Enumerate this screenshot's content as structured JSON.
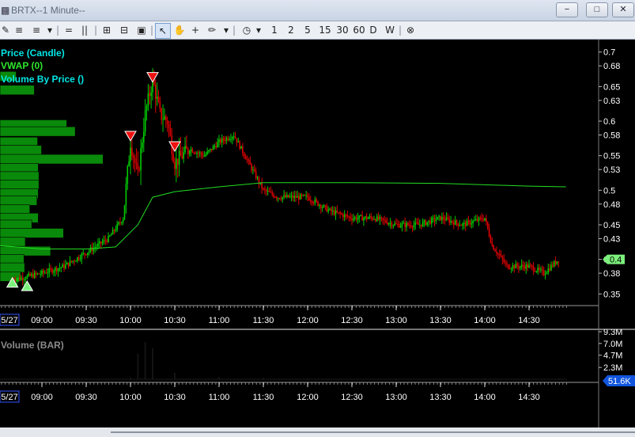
{
  "window": {
    "title": "BRTX--1 Minute--",
    "buttons": [
      "−",
      "□",
      "✕"
    ]
  },
  "toolbar": {
    "intervals": [
      "1",
      "2",
      "5",
      "15",
      "30",
      "60",
      "D",
      "W"
    ]
  },
  "price_legend": [
    {
      "label": "Price (Candle)",
      "color": "#00e5e5"
    },
    {
      "label": "VWAP (0)",
      "color": "#2ee62e"
    },
    {
      "label": "Volume By Price ()",
      "color": "#00e5e5"
    }
  ],
  "volume_legend": {
    "label": "Volume (BAR)",
    "color": "#8a8a8a"
  },
  "current_price_label": "0.4",
  "current_volume_label": "51.6K",
  "colors": {
    "background": "#000000",
    "up_candle": "#00cc00",
    "down_candle": "#dd0000",
    "vwap": "#22dd22",
    "volume_profile": "#0a8a0a",
    "axis_text": "#ffffff",
    "current_price_badge": "#7cf07c",
    "current_volume_badge": "#1155dd"
  },
  "chart_data": [
    {
      "type": "candlestick",
      "title": "Price (Candle)",
      "x_ticks": [
        "5/27",
        "09:00",
        "09:30",
        "10:00",
        "10:30",
        "11:00",
        "11:30",
        "12:00",
        "12:30",
        "13:00",
        "13:30",
        "14:00",
        "14:30"
      ],
      "y_ticks": [
        0.7,
        0.68,
        0.65,
        0.63,
        0.6,
        0.58,
        0.55,
        0.53,
        0.5,
        0.48,
        0.45,
        0.43,
        0.4,
        0.38,
        0.35
      ],
      "ylim": [
        0.34,
        0.71
      ],
      "series": [
        {
          "name": "Price (Candle)",
          "approx_path": [
            {
              "t": "08:40",
              "price": 0.37
            },
            {
              "t": "09:00",
              "price": 0.38
            },
            {
              "t": "09:15",
              "price": 0.39
            },
            {
              "t": "09:30",
              "price": 0.41
            },
            {
              "t": "09:45",
              "price": 0.43
            },
            {
              "t": "09:55",
              "price": 0.46
            },
            {
              "t": "10:00",
              "price": 0.57
            },
            {
              "t": "10:05",
              "price": 0.52
            },
            {
              "t": "10:10",
              "price": 0.61
            },
            {
              "t": "10:15",
              "price": 0.66
            },
            {
              "t": "10:20",
              "price": 0.61
            },
            {
              "t": "10:25",
              "price": 0.6
            },
            {
              "t": "10:30",
              "price": 0.54
            },
            {
              "t": "10:40",
              "price": 0.56
            },
            {
              "t": "10:50",
              "price": 0.55
            },
            {
              "t": "11:00",
              "price": 0.57
            },
            {
              "t": "11:10",
              "price": 0.58
            },
            {
              "t": "11:20",
              "price": 0.54
            },
            {
              "t": "11:30",
              "price": 0.5
            },
            {
              "t": "11:40",
              "price": 0.49
            },
            {
              "t": "12:00",
              "price": 0.49
            },
            {
              "t": "12:15",
              "price": 0.47
            },
            {
              "t": "12:30",
              "price": 0.46
            },
            {
              "t": "12:45",
              "price": 0.46
            },
            {
              "t": "13:00",
              "price": 0.45
            },
            {
              "t": "13:15",
              "price": 0.45
            },
            {
              "t": "13:30",
              "price": 0.46
            },
            {
              "t": "13:45",
              "price": 0.45
            },
            {
              "t": "14:00",
              "price": 0.46
            },
            {
              "t": "14:05",
              "price": 0.42
            },
            {
              "t": "14:15",
              "price": 0.39
            },
            {
              "t": "14:30",
              "price": 0.39
            },
            {
              "t": "14:40",
              "price": 0.38
            },
            {
              "t": "14:50",
              "price": 0.4
            }
          ]
        },
        {
          "name": "VWAP (0)",
          "points": [
            {
              "t": "08:30",
              "price": 0.42
            },
            {
              "t": "09:00",
              "price": 0.415
            },
            {
              "t": "09:30",
              "price": 0.415
            },
            {
              "t": "09:50",
              "price": 0.418
            },
            {
              "t": "10:05",
              "price": 0.45
            },
            {
              "t": "10:15",
              "price": 0.49
            },
            {
              "t": "10:30",
              "price": 0.498
            },
            {
              "t": "11:00",
              "price": 0.505
            },
            {
              "t": "11:30",
              "price": 0.511
            },
            {
              "t": "12:30",
              "price": 0.511
            },
            {
              "t": "13:30",
              "price": 0.51
            },
            {
              "t": "14:30",
              "price": 0.506
            },
            {
              "t": "14:55",
              "price": 0.505
            }
          ]
        }
      ],
      "signals": [
        {
          "t": "08:40",
          "price": 0.37,
          "kind": "buy"
        },
        {
          "t": "08:50",
          "price": 0.365,
          "kind": "buy"
        },
        {
          "t": "10:00",
          "price": 0.575,
          "kind": "sell"
        },
        {
          "t": "10:15",
          "price": 0.66,
          "kind": "sell"
        },
        {
          "t": "10:30",
          "price": 0.56,
          "kind": "sell"
        }
      ],
      "volume_by_price": [
        {
          "price": 0.665,
          "volume": 2.5
        },
        {
          "price": 0.645,
          "volume": 5.3
        },
        {
          "price": 0.595,
          "volume": 10.3
        },
        {
          "price": 0.585,
          "volume": 11.6
        },
        {
          "price": 0.57,
          "volume": 5.8
        },
        {
          "price": 0.558,
          "volume": 6.4
        },
        {
          "price": 0.545,
          "volume": 15.9
        },
        {
          "price": 0.532,
          "volume": 5.9
        },
        {
          "price": 0.52,
          "volume": 6.0
        },
        {
          "price": 0.508,
          "volume": 6.0
        },
        {
          "price": 0.495,
          "volume": 5.9
        },
        {
          "price": 0.485,
          "volume": 5.7
        },
        {
          "price": 0.472,
          "volume": 4.6
        },
        {
          "price": 0.46,
          "volume": 5.9
        },
        {
          "price": 0.45,
          "volume": 4.9
        },
        {
          "price": 0.438,
          "volume": 9.8
        },
        {
          "price": 0.425,
          "volume": 3.9
        },
        {
          "price": 0.412,
          "volume": 7.8
        },
        {
          "price": 0.4,
          "volume": 3.7
        },
        {
          "price": 0.388,
          "volume": 3.8
        },
        {
          "price": 0.375,
          "volume": 3.2
        }
      ]
    },
    {
      "type": "bar",
      "title": "Volume (BAR)",
      "x_ticks": [
        "5/27",
        "09:00",
        "09:30",
        "10:00",
        "10:30",
        "11:00",
        "11:30",
        "12:00",
        "12:30",
        "13:00",
        "13:30",
        "14:00",
        "14:30"
      ],
      "y_ticks": [
        "9.3M",
        "7.0M",
        "4.7M",
        "2.3M"
      ],
      "ylim": [
        0,
        9.3
      ],
      "approx_values_millions": [
        {
          "t": "09:00",
          "volume": 0.1
        },
        {
          "t": "09:30",
          "volume": 0.1
        },
        {
          "t": "10:00",
          "volume": 0.35
        },
        {
          "t": "10:05",
          "volume": 4.9
        },
        {
          "t": "10:10",
          "volume": 7.2
        },
        {
          "t": "10:15",
          "volume": 6.0
        },
        {
          "t": "10:30",
          "volume": 1.2
        },
        {
          "t": "11:00",
          "volume": 0.4
        },
        {
          "t": "11:30",
          "volume": 0.2
        },
        {
          "t": "12:00",
          "volume": 0.1
        },
        {
          "t": "13:00",
          "volume": 0.05
        },
        {
          "t": "14:00",
          "volume": 0.1
        },
        {
          "t": "14:50",
          "volume": 0.05
        }
      ]
    }
  ]
}
